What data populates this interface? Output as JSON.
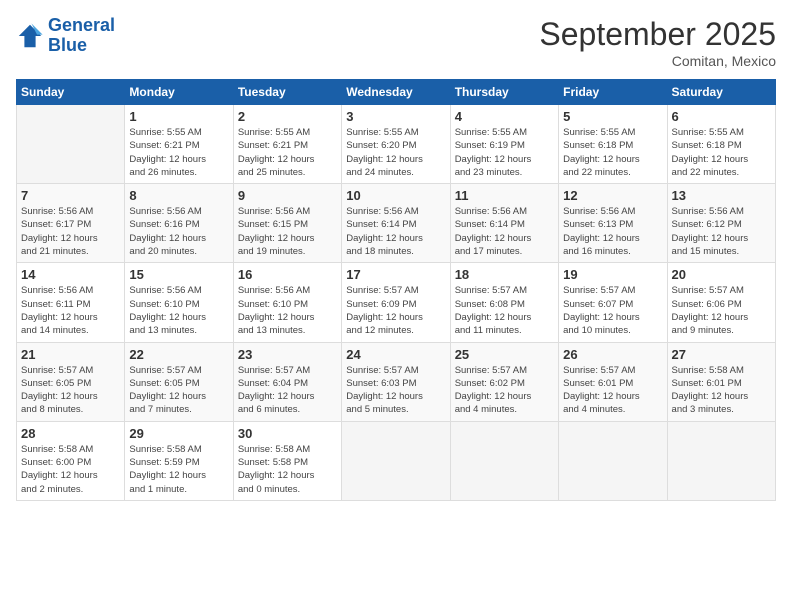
{
  "header": {
    "logo_line1": "General",
    "logo_line2": "Blue",
    "month": "September 2025",
    "location": "Comitan, Mexico"
  },
  "days_of_week": [
    "Sunday",
    "Monday",
    "Tuesday",
    "Wednesday",
    "Thursday",
    "Friday",
    "Saturday"
  ],
  "weeks": [
    [
      {
        "day": "",
        "info": ""
      },
      {
        "day": "1",
        "info": "Sunrise: 5:55 AM\nSunset: 6:21 PM\nDaylight: 12 hours\nand 26 minutes."
      },
      {
        "day": "2",
        "info": "Sunrise: 5:55 AM\nSunset: 6:21 PM\nDaylight: 12 hours\nand 25 minutes."
      },
      {
        "day": "3",
        "info": "Sunrise: 5:55 AM\nSunset: 6:20 PM\nDaylight: 12 hours\nand 24 minutes."
      },
      {
        "day": "4",
        "info": "Sunrise: 5:55 AM\nSunset: 6:19 PM\nDaylight: 12 hours\nand 23 minutes."
      },
      {
        "day": "5",
        "info": "Sunrise: 5:55 AM\nSunset: 6:18 PM\nDaylight: 12 hours\nand 22 minutes."
      },
      {
        "day": "6",
        "info": "Sunrise: 5:55 AM\nSunset: 6:18 PM\nDaylight: 12 hours\nand 22 minutes."
      }
    ],
    [
      {
        "day": "7",
        "info": "Sunrise: 5:56 AM\nSunset: 6:17 PM\nDaylight: 12 hours\nand 21 minutes."
      },
      {
        "day": "8",
        "info": "Sunrise: 5:56 AM\nSunset: 6:16 PM\nDaylight: 12 hours\nand 20 minutes."
      },
      {
        "day": "9",
        "info": "Sunrise: 5:56 AM\nSunset: 6:15 PM\nDaylight: 12 hours\nand 19 minutes."
      },
      {
        "day": "10",
        "info": "Sunrise: 5:56 AM\nSunset: 6:14 PM\nDaylight: 12 hours\nand 18 minutes."
      },
      {
        "day": "11",
        "info": "Sunrise: 5:56 AM\nSunset: 6:14 PM\nDaylight: 12 hours\nand 17 minutes."
      },
      {
        "day": "12",
        "info": "Sunrise: 5:56 AM\nSunset: 6:13 PM\nDaylight: 12 hours\nand 16 minutes."
      },
      {
        "day": "13",
        "info": "Sunrise: 5:56 AM\nSunset: 6:12 PM\nDaylight: 12 hours\nand 15 minutes."
      }
    ],
    [
      {
        "day": "14",
        "info": "Sunrise: 5:56 AM\nSunset: 6:11 PM\nDaylight: 12 hours\nand 14 minutes."
      },
      {
        "day": "15",
        "info": "Sunrise: 5:56 AM\nSunset: 6:10 PM\nDaylight: 12 hours\nand 13 minutes."
      },
      {
        "day": "16",
        "info": "Sunrise: 5:56 AM\nSunset: 6:10 PM\nDaylight: 12 hours\nand 13 minutes."
      },
      {
        "day": "17",
        "info": "Sunrise: 5:57 AM\nSunset: 6:09 PM\nDaylight: 12 hours\nand 12 minutes."
      },
      {
        "day": "18",
        "info": "Sunrise: 5:57 AM\nSunset: 6:08 PM\nDaylight: 12 hours\nand 11 minutes."
      },
      {
        "day": "19",
        "info": "Sunrise: 5:57 AM\nSunset: 6:07 PM\nDaylight: 12 hours\nand 10 minutes."
      },
      {
        "day": "20",
        "info": "Sunrise: 5:57 AM\nSunset: 6:06 PM\nDaylight: 12 hours\nand 9 minutes."
      }
    ],
    [
      {
        "day": "21",
        "info": "Sunrise: 5:57 AM\nSunset: 6:05 PM\nDaylight: 12 hours\nand 8 minutes."
      },
      {
        "day": "22",
        "info": "Sunrise: 5:57 AM\nSunset: 6:05 PM\nDaylight: 12 hours\nand 7 minutes."
      },
      {
        "day": "23",
        "info": "Sunrise: 5:57 AM\nSunset: 6:04 PM\nDaylight: 12 hours\nand 6 minutes."
      },
      {
        "day": "24",
        "info": "Sunrise: 5:57 AM\nSunset: 6:03 PM\nDaylight: 12 hours\nand 5 minutes."
      },
      {
        "day": "25",
        "info": "Sunrise: 5:57 AM\nSunset: 6:02 PM\nDaylight: 12 hours\nand 4 minutes."
      },
      {
        "day": "26",
        "info": "Sunrise: 5:57 AM\nSunset: 6:01 PM\nDaylight: 12 hours\nand 4 minutes."
      },
      {
        "day": "27",
        "info": "Sunrise: 5:58 AM\nSunset: 6:01 PM\nDaylight: 12 hours\nand 3 minutes."
      }
    ],
    [
      {
        "day": "28",
        "info": "Sunrise: 5:58 AM\nSunset: 6:00 PM\nDaylight: 12 hours\nand 2 minutes."
      },
      {
        "day": "29",
        "info": "Sunrise: 5:58 AM\nSunset: 5:59 PM\nDaylight: 12 hours\nand 1 minute."
      },
      {
        "day": "30",
        "info": "Sunrise: 5:58 AM\nSunset: 5:58 PM\nDaylight: 12 hours\nand 0 minutes."
      },
      {
        "day": "",
        "info": ""
      },
      {
        "day": "",
        "info": ""
      },
      {
        "day": "",
        "info": ""
      },
      {
        "day": "",
        "info": ""
      }
    ]
  ]
}
